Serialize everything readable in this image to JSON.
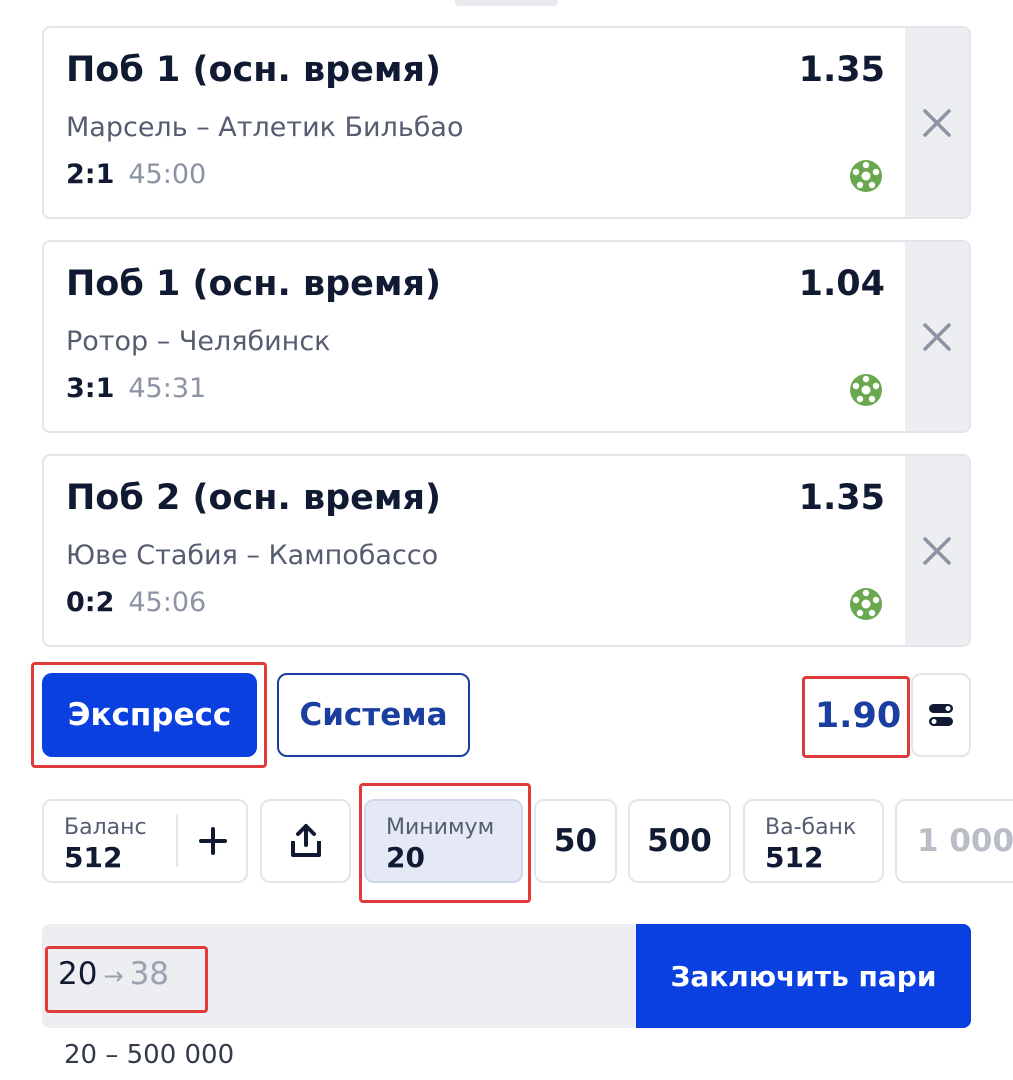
{
  "bets": [
    {
      "market": "Поб 1 (осн. время)",
      "odds": "1.35",
      "teams": "Марсель – Атлетик Бильбао",
      "score": "2:1",
      "time": "45:00",
      "sport_icon": "soccer-ball-icon"
    },
    {
      "market": "Поб 1 (осн. время)",
      "odds": "1.04",
      "teams": "Ротор – Челябинск",
      "score": "3:1",
      "time": "45:31",
      "sport_icon": "soccer-ball-icon"
    },
    {
      "market": "Поб 2 (осн. время)",
      "odds": "1.35",
      "teams": "Юве Стабия – Кампобассо",
      "score": "0:2",
      "time": "45:06",
      "sport_icon": "soccer-ball-icon"
    }
  ],
  "bet_mode": {
    "express_label": "Экспресс",
    "system_label": "Система",
    "selected": "Экспресс",
    "total_odds": "1.90"
  },
  "quick_stakes": {
    "balance_label": "Баланс",
    "balance_value": "512",
    "min_label": "Минимум",
    "min_value": "20",
    "chip_50": "50",
    "chip_500": "500",
    "allin_label": "Ва-банк",
    "allin_value": "512",
    "chip_1000": "1 000"
  },
  "submit": {
    "stake": "20",
    "arrow": "→",
    "payout": "38",
    "button_label": "Заключить пари",
    "limits": "20 – 500 000"
  },
  "colors": {
    "accent": "#0a3fe0",
    "text_dark": "#111a33",
    "soccer_icon": "#6aa84f",
    "highlight": "#e03a3a"
  }
}
